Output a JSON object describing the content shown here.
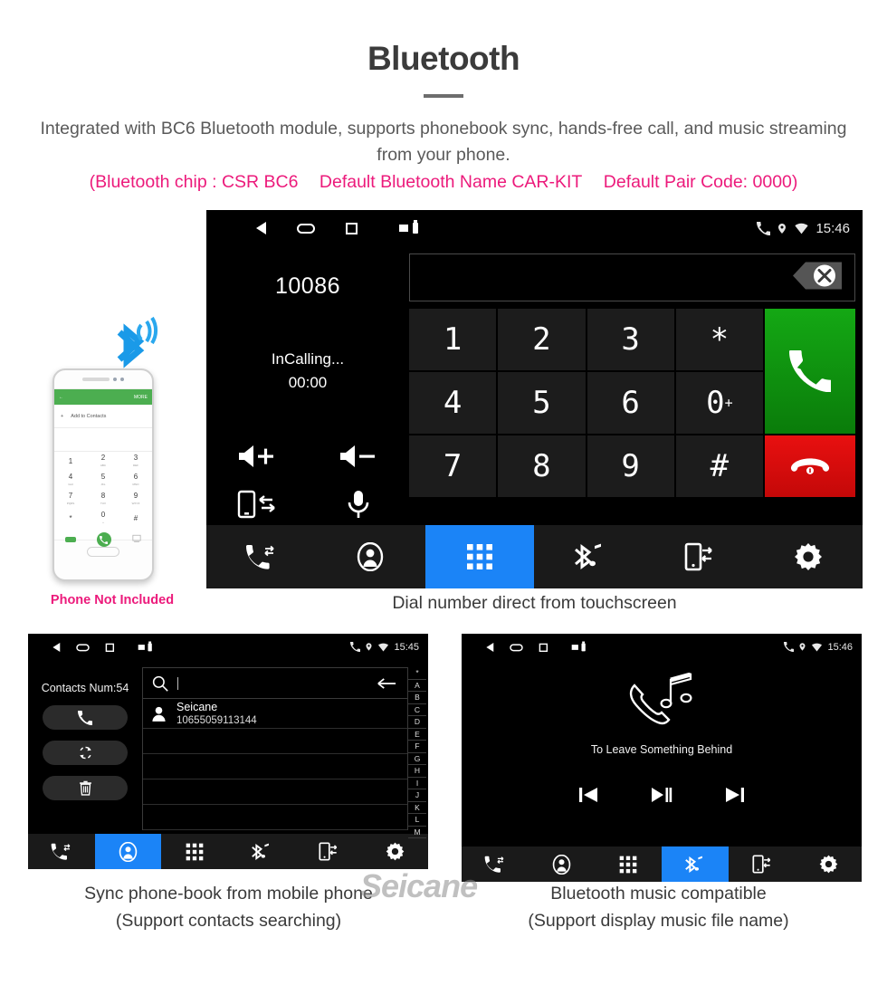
{
  "header": {
    "title": "Bluetooth",
    "subtitle": "Integrated with BC6 Bluetooth module, supports phonebook sync, hands-free call, and music streaming from your phone.",
    "specs": [
      "(Bluetooth chip : CSR BC6",
      "Default Bluetooth Name CAR-KIT",
      "Default Pair Code: 0000)"
    ],
    "accent_color": "#ec1a7b",
    "title_color": "#3b3b3b"
  },
  "phone_mock": {
    "bluetooth_icon": "bluetooth-signal-icon",
    "bluetooth_color": "#1a9ae8",
    "screen": {
      "header_more": "MORE",
      "add_contacts": "Add to Contacts",
      "keys": [
        {
          "digit": "1",
          "letters": ""
        },
        {
          "digit": "2",
          "letters": "ABC"
        },
        {
          "digit": "3",
          "letters": "DEF"
        },
        {
          "digit": "4",
          "letters": "GHI"
        },
        {
          "digit": "5",
          "letters": "JKL"
        },
        {
          "digit": "6",
          "letters": "MNO"
        },
        {
          "digit": "7",
          "letters": "PQRS"
        },
        {
          "digit": "8",
          "letters": "TUV"
        },
        {
          "digit": "9",
          "letters": "WXYZ"
        },
        {
          "digit": "*",
          "letters": ""
        },
        {
          "digit": "0",
          "letters": "+"
        },
        {
          "digit": "#",
          "letters": ""
        }
      ],
      "header_color": "#4cae50"
    },
    "disclaimer": "Phone Not Included"
  },
  "dialer": {
    "status_bar": {
      "time": "15:46",
      "icons": [
        "back-icon",
        "home-icon",
        "recent-apps-icon",
        "sd-card-icon",
        "usb-icon",
        "phone-icon",
        "location-icon",
        "wifi-icon"
      ]
    },
    "number": "10086",
    "call_state": "InCalling...",
    "timer": "00:00",
    "controls": [
      {
        "name": "volume-up-icon",
        "label": "Volume Up"
      },
      {
        "name": "volume-down-icon",
        "label": "Volume Down"
      },
      {
        "name": "transfer-audio-icon",
        "label": "Transfer to Phone"
      },
      {
        "name": "microphone-icon",
        "label": "Mute Microphone"
      }
    ],
    "input_value": "",
    "backspace_icon": "backspace-icon",
    "keys": [
      "1",
      "2",
      "3",
      "*",
      "4",
      "5",
      "6",
      "0",
      "7",
      "8",
      "9",
      "#"
    ],
    "zero_sub": "+",
    "call_button": {
      "name": "call-button",
      "color": "#14a814"
    },
    "end_button": {
      "name": "end-call-button",
      "color": "#e81010"
    },
    "caption": "Dial number direct from touchscreen"
  },
  "tabs": [
    {
      "name": "tab-call-history",
      "icon": "call-history-icon"
    },
    {
      "name": "tab-contacts",
      "icon": "contacts-icon"
    },
    {
      "name": "tab-keypad",
      "icon": "keypad-icon"
    },
    {
      "name": "tab-bluetooth-music",
      "icon": "bluetooth-music-icon"
    },
    {
      "name": "tab-phone-sync",
      "icon": "phone-sync-icon"
    },
    {
      "name": "tab-settings",
      "icon": "settings-gear-icon"
    }
  ],
  "active_tab_color": "#1b84f7",
  "contacts_panel": {
    "status_time": "15:45",
    "count_label": "Contacts Num:54",
    "side_buttons": [
      {
        "name": "call-contact-button",
        "icon": "phone-icon"
      },
      {
        "name": "sync-contacts-button",
        "icon": "refresh-icon"
      },
      {
        "name": "delete-contacts-button",
        "icon": "trash-icon"
      }
    ],
    "search_placeholder": "",
    "search_value": "",
    "contact": {
      "name": "Seicane",
      "number": "10655059113144"
    },
    "alpha_index": [
      "*",
      "A",
      "B",
      "C",
      "D",
      "E",
      "F",
      "G",
      "H",
      "I",
      "J",
      "K",
      "L",
      "M"
    ],
    "active_tab": 1,
    "caption_line1": "Sync phone-book from mobile phone",
    "caption_line2": "(Support contacts searching)"
  },
  "music_panel": {
    "status_time": "15:46",
    "track_title": "To Leave Something Behind",
    "icon": "phone-music-icon",
    "controls": [
      {
        "name": "previous-track-button",
        "icon": "prev-icon"
      },
      {
        "name": "play-pause-button",
        "icon": "play-pause-icon"
      },
      {
        "name": "next-track-button",
        "icon": "next-icon"
      }
    ],
    "active_tab": 3,
    "caption_line1": "Bluetooth music compatible",
    "caption_line2": "(Support display music file name)"
  },
  "watermark": "Seicane"
}
